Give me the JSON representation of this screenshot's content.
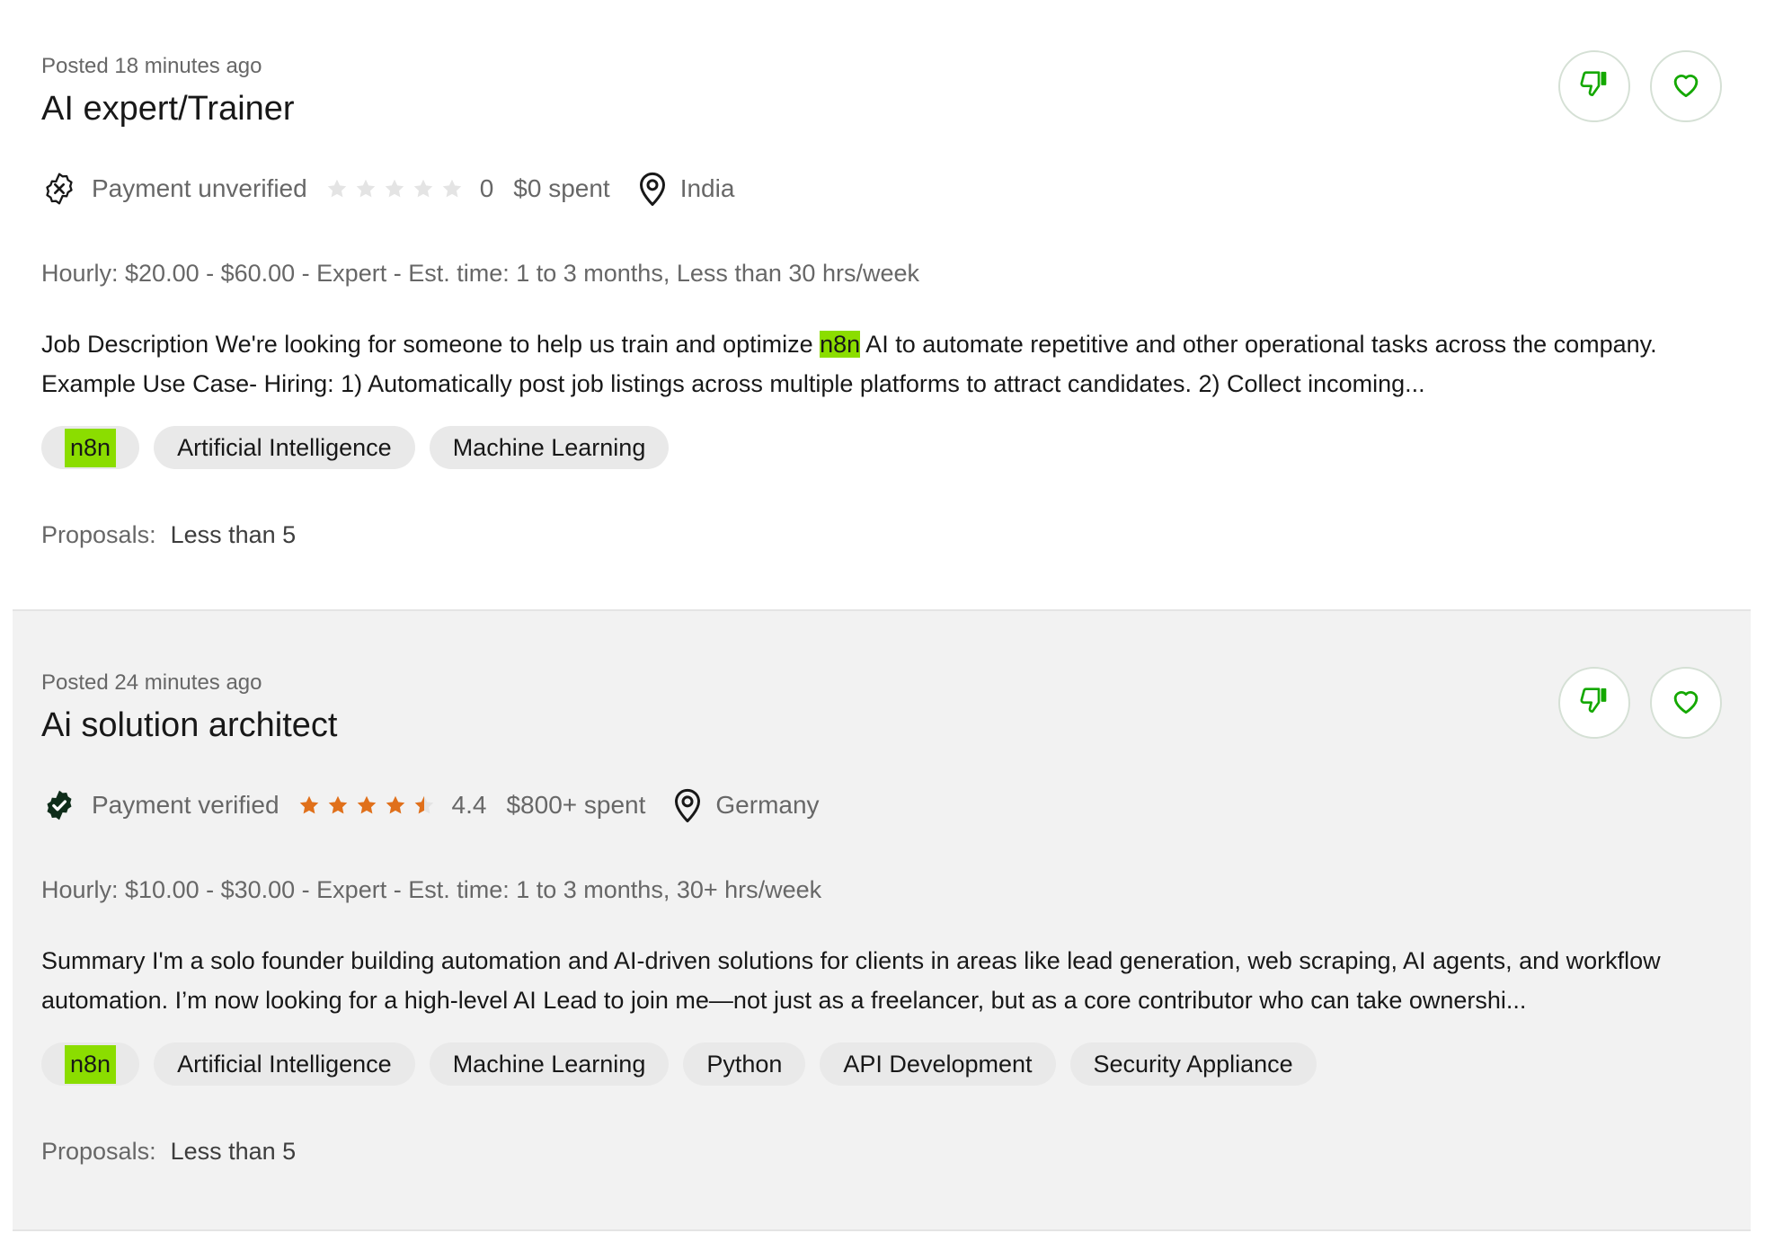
{
  "colors": {
    "accent_green": "#14a800",
    "highlight": "#8bdd00",
    "star_filled": "#e0701b",
    "star_empty": "#e4e4e4"
  },
  "jobs": [
    {
      "posted": "Posted 18 minutes ago",
      "title": "AI expert/Trainer",
      "payment_status": "Payment unverified",
      "payment_icon": "unverified-badge-icon",
      "rating_stars": 0,
      "rating_value": "0",
      "spent": "$0 spent",
      "location": "India",
      "budget": "Hourly: $20.00 - $60.00 - Expert - Est. time: 1 to 3 months, Less than 30 hrs/week",
      "description_before": "Job Description We're looking for someone to help us train and optimize ",
      "description_highlight": "n8n",
      "description_after": " AI to automate repetitive and other operational tasks across the company. Example Use Case- Hiring: 1) Automatically post job listings across multiple platforms to attract candidates. 2) Collect incoming...",
      "tags": [
        "n8n",
        "Artificial Intelligence",
        "Machine Learning"
      ],
      "proposals_label": "Proposals:",
      "proposals_value": "Less than 5"
    },
    {
      "posted": "Posted 24 minutes ago",
      "title": "Ai solution architect",
      "payment_status": "Payment verified",
      "payment_icon": "verified-badge-icon",
      "rating_stars": 4.4,
      "rating_value": "4.4",
      "spent": "$800+ spent",
      "location": "Germany",
      "budget": "Hourly: $10.00 - $30.00 - Expert - Est. time: 1 to 3 months, 30+ hrs/week",
      "description_before": "Summary I'm a solo founder building automation and AI-driven solutions for clients in areas like lead generation, web scraping, AI agents, and workflow automation. I’m now looking for a high-level AI Lead to join me—not just as a freelancer, but as a core contributor who can take ownershi...",
      "description_highlight": "",
      "description_after": "",
      "tags": [
        "n8n",
        "Artificial Intelligence",
        "Machine Learning",
        "Python",
        "API Development",
        "Security Appliance"
      ],
      "proposals_label": "Proposals:",
      "proposals_value": "Less than 5"
    }
  ]
}
